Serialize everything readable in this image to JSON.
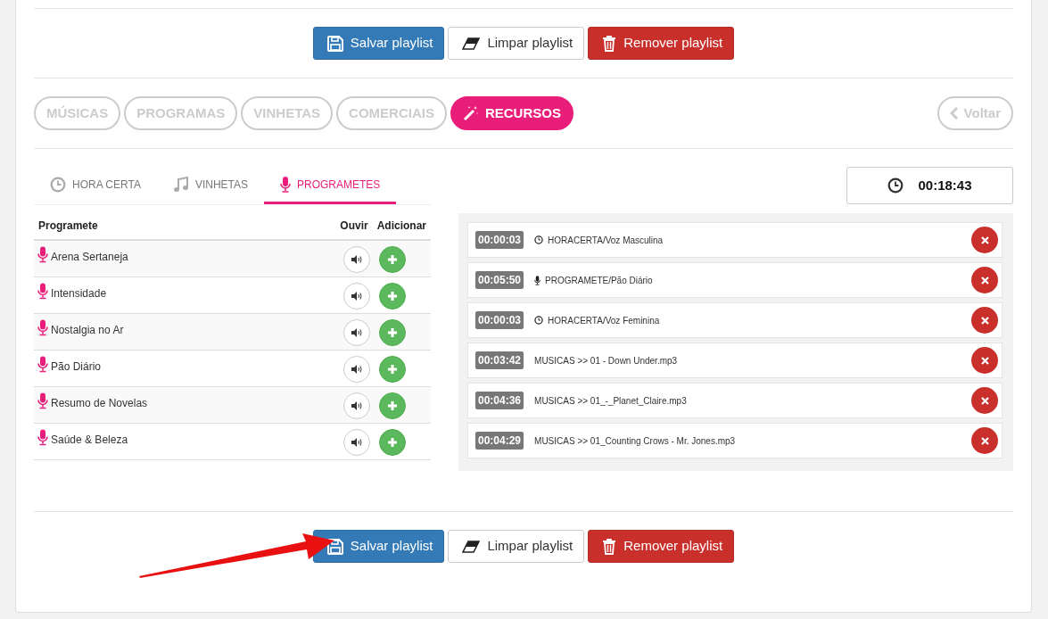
{
  "top_actions": [
    {
      "kind": "save",
      "label": "Salvar playlist"
    },
    {
      "kind": "clear",
      "label": "Limpar playlist"
    },
    {
      "kind": "remove",
      "label": "Remover playlist"
    }
  ],
  "category_tabs": [
    {
      "label": "MÚSICAS",
      "selected": false
    },
    {
      "label": "PROGRAMAS",
      "selected": false
    },
    {
      "label": "VINHETAS",
      "selected": false
    },
    {
      "label": "COMERCIAIS",
      "selected": false
    },
    {
      "label": "RECURSOS",
      "selected": true
    }
  ],
  "back_button": {
    "label": "Voltar"
  },
  "sub_tabs": [
    {
      "kind": "clock",
      "label": "HORA CERTA",
      "selected": false
    },
    {
      "kind": "note",
      "label": "VINHETAS",
      "selected": false
    },
    {
      "kind": "mic",
      "label": "PROGRAMETES",
      "selected": true
    }
  ],
  "table": {
    "columns": [
      "Programete",
      "Ouvir",
      "Adicionar"
    ],
    "rows": [
      {
        "name": "Arena Sertaneja"
      },
      {
        "name": "Intensidade"
      },
      {
        "name": "Nostalgia no Ar"
      },
      {
        "name": "Pão Diário"
      },
      {
        "name": "Resumo de Novelas"
      },
      {
        "name": "Saúde & Beleza"
      }
    ]
  },
  "total_time": "00:18:43",
  "playlist": [
    {
      "duration": "00:00:03",
      "kind": "clock",
      "text": "HORACERTA/Voz Masculina"
    },
    {
      "duration": "00:05:50",
      "kind": "mic",
      "text": "PROGRAMETE/Pão Diário"
    },
    {
      "duration": "00:00:03",
      "kind": "clock",
      "text": "HORACERTA/Voz Feminina"
    },
    {
      "duration": "00:03:42",
      "kind": "music",
      "text": "MUSICAS >> 01 - Down Under.mp3"
    },
    {
      "duration": "00:04:36",
      "kind": "music",
      "text": "MUSICAS >> 01_-_Planet_Claire.mp3"
    },
    {
      "duration": "00:04:29",
      "kind": "music",
      "text": "MUSICAS >> 01_Counting Crows - Mr. Jones.mp3"
    }
  ],
  "bottom_actions": [
    {
      "kind": "save",
      "label": "Salvar playlist"
    },
    {
      "kind": "clear",
      "label": "Limpar playlist"
    },
    {
      "kind": "remove",
      "label": "Remover playlist"
    }
  ]
}
